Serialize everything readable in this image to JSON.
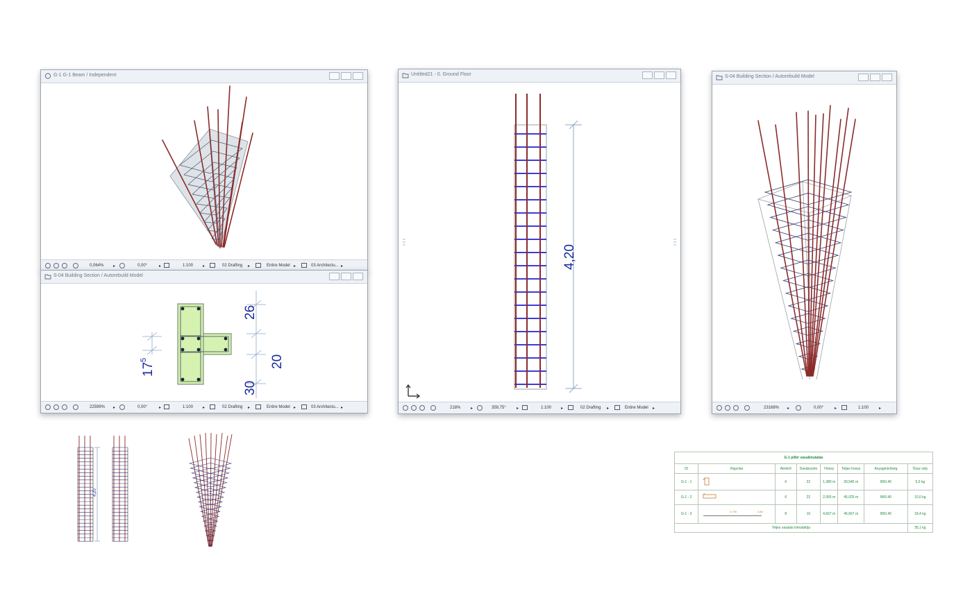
{
  "windows": {
    "beam3d": {
      "title": "G-1 G-1 Beam / Independent",
      "status": {
        "zoom": "0,064%",
        "angle": "0,00°",
        "scale": "1:100",
        "layer": "02 Drafting",
        "model": "Entire Model",
        "structure": "03 Architectu..."
      }
    },
    "section": {
      "title": "S-04 Building Section / Autorebuild Model",
      "status": {
        "zoom": "22599%",
        "angle": "0,00°",
        "scale": "1:100",
        "layer": "02 Drafting",
        "model": "Entire Model",
        "structure": "03 Architectu..."
      },
      "dims": {
        "top": "26",
        "right": "20",
        "left": "17",
        "left_sup": "5",
        "bottom": "30"
      }
    },
    "plan": {
      "title": "Untitled21 - 0. Ground Floor",
      "status": {
        "zoom": "218%",
        "angle": "359,75°",
        "scale": "1:100",
        "layer": "02 Drafting",
        "model": "Entire Model"
      },
      "dim": "4,20"
    },
    "model3d": {
      "title": "S-04 Building Section / Autorebuild Model",
      "status": {
        "zoom": "23168%",
        "angle": "0,00°",
        "scale": "1:100"
      }
    }
  },
  "bottom_drawing": {
    "dim": "4,20"
  },
  "schedule": {
    "title": "G-1 pillér vasalimutatás",
    "headers": [
      "ID",
      "Rajzolat",
      "Átmérő",
      "Darabszám",
      "Hossz",
      "Teljes hossz",
      "Anyagminőség",
      "Össz súly"
    ],
    "rows": [
      {
        "id": "G-1 - 1",
        "diameter": "6",
        "count": "22",
        "length": "1,380 m",
        "total": "30,545 m",
        "material": "B60.40",
        "weight": "5,0 kg"
      },
      {
        "id": "G-1 - 2",
        "diameter": "6",
        "count": "22",
        "length": "2,065 m",
        "total": "45,025 m",
        "material": "B60.40",
        "weight": "10,0 kg"
      },
      {
        "id": "G-1 - 3",
        "diameter": "8",
        "count": "10",
        "length": "4,667 m",
        "total": "46,667 m",
        "material": "B60.40",
        "weight": "18,4 kg"
      }
    ],
    "row3_drawing_labels": [
      "4,700",
      "4,80"
    ],
    "footer_label": "Teljes vasalás kimutatója",
    "footer_value": "35,1 kg"
  },
  "colors": {
    "rebar": "#8b2a2a",
    "stirrup": "#1f1fd6",
    "dimension": "#1a2b9a",
    "section_fill": "#d5f2b0",
    "schedule_text": "#1f8a3a"
  }
}
